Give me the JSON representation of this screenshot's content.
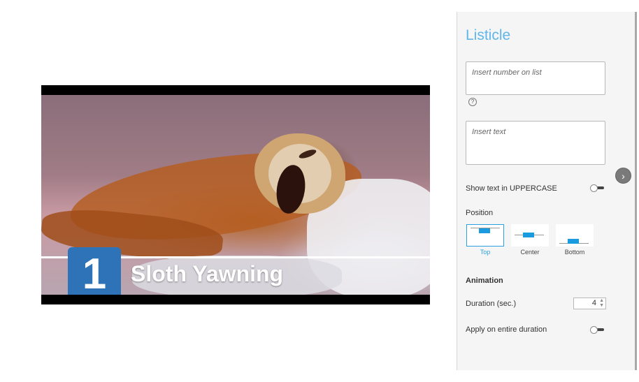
{
  "preview": {
    "list_number": "1",
    "caption": "Sloth Yawning",
    "badge_color": "#2e73b8"
  },
  "panel": {
    "title": "Listicle",
    "number_placeholder": "Insert number on list",
    "help_icon": "?",
    "text_placeholder": "Insert text",
    "uppercase_label": "Show text in UPPERCASE",
    "uppercase_on": false,
    "position_label": "Position",
    "positions": [
      {
        "label": "Top",
        "selected": true
      },
      {
        "label": "Center",
        "selected": false
      },
      {
        "label": "Bottom",
        "selected": false
      }
    ],
    "animation_label": "Animation",
    "duration_label": "Duration (sec.)",
    "duration_value": "4",
    "apply_label": "Apply on entire duration",
    "apply_on": false,
    "accent_color": "#5fb6ea"
  },
  "collapse_icon": "›"
}
